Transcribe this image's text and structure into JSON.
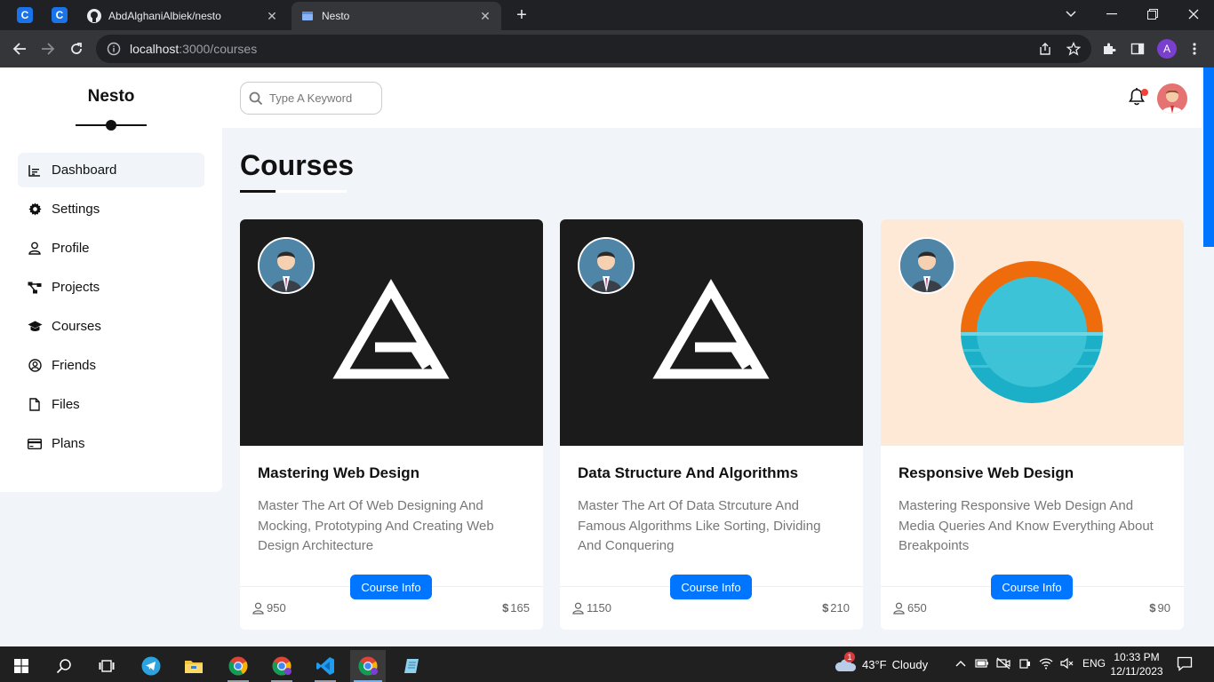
{
  "browser": {
    "tabs": [
      {
        "title": "AbdAlghaniAlbiek/nesto",
        "active": false
      },
      {
        "title": "Nesto",
        "active": true
      }
    ],
    "url_host": "localhost",
    "url_path": ":3000/courses",
    "profile_initial": "A"
  },
  "sidebar": {
    "brand": "Nesto",
    "items": [
      {
        "label": "Dashboard",
        "icon": "chart-icon",
        "active": true
      },
      {
        "label": "Settings",
        "icon": "gear-icon"
      },
      {
        "label": "Profile",
        "icon": "user-icon"
      },
      {
        "label": "Projects",
        "icon": "diagram-icon"
      },
      {
        "label": "Courses",
        "icon": "graduation-cap-icon"
      },
      {
        "label": "Friends",
        "icon": "user-circle-icon"
      },
      {
        "label": "Files",
        "icon": "file-icon"
      },
      {
        "label": "Plans",
        "icon": "credit-card-icon"
      }
    ]
  },
  "topbar": {
    "search_placeholder": "Type A Keyword"
  },
  "page": {
    "title": "Courses"
  },
  "courses": [
    {
      "title": "Mastering Web Design",
      "description": "Master The Art Of Web Designing And Mocking, Prototyping And Creating Web Design Architecture",
      "button": "Course Info",
      "students": "950",
      "price": "165",
      "cover": "triangle-logo-dark"
    },
    {
      "title": "Data Structure And Algorithms",
      "description": "Master The Art Of Data Strcuture And Famous Algorithms Like Sorting, Dividing And Conquering",
      "button": "Course Info",
      "students": "1150",
      "price": "210",
      "cover": "triangle-logo-dark"
    },
    {
      "title": "Responsive Web Design",
      "description": "Mastering Responsive Web Design And Media Queries And Know Everything About Breakpoints",
      "button": "Course Info",
      "students": "650",
      "price": "90",
      "cover": "sunset-circle"
    }
  ],
  "taskbar": {
    "weather_badge": "1",
    "weather_temp": "43°F",
    "weather_text": "Cloudy",
    "language": "ENG",
    "time": "10:33 PM",
    "date": "12/11/2023"
  },
  "colors": {
    "accent": "#0075ff",
    "page_bg": "#f1f5f9",
    "dark_cover": "#1b1b1b",
    "peach_cover": "#fde9d6"
  }
}
